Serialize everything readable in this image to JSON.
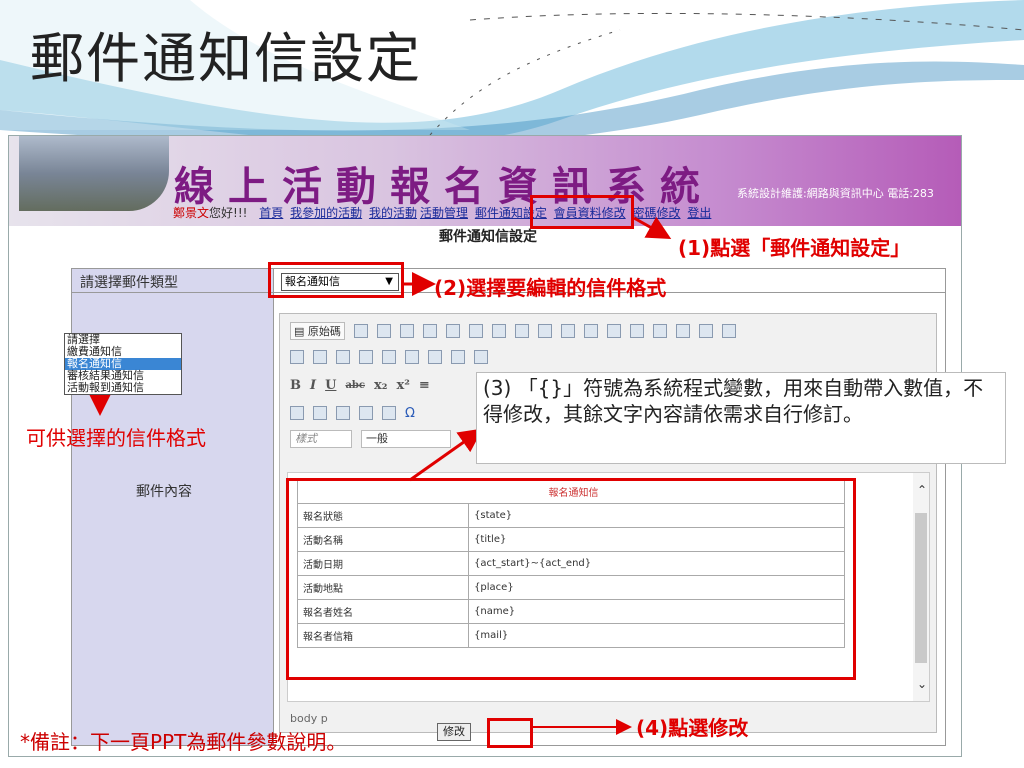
{
  "slide": {
    "title": "郵件通知信設定",
    "note": "*備註：下一頁PPT為郵件參數說明。"
  },
  "app": {
    "system_title": "線上活動報名資訊系統",
    "maintenance_text": "系統設計維護:網路與資訊中心 電話:283",
    "user_name": "鄭景文",
    "greeting": "您好!!!",
    "nav": [
      "首頁",
      "我參加的活動",
      "我的活動",
      "活動管理",
      "郵件通知設定",
      "會員資料修改",
      "密碼修改",
      "登出"
    ],
    "page_heading": "郵件通知信設定"
  },
  "form": {
    "type_label": "請選擇郵件類型",
    "type_selected": "報名通知信",
    "type_options": [
      "請選擇",
      "繳費通知信",
      "報名通知信",
      "審核結果通知信",
      "活動報到通知信"
    ],
    "content_label": "郵件內容",
    "modify_label": "修改"
  },
  "editor": {
    "source_label": "原始碼",
    "style_combo": "樣式",
    "format_combo": "一般",
    "path": "body  p",
    "template_header": "報名通知信",
    "rows": [
      {
        "label": "報名狀態",
        "value": "{state}"
      },
      {
        "label": "活動名稱",
        "value": "{title}"
      },
      {
        "label": "活動日期",
        "value": "{act_start}~{act_end}"
      },
      {
        "label": "活動地點",
        "value": "{place}"
      },
      {
        "label": "報名者姓名",
        "value": "{name}"
      },
      {
        "label": "報名者信箱",
        "value": "{mail}"
      }
    ]
  },
  "annotations": {
    "a1": "(1)點選「郵件通知設定」",
    "a2": "(2)選擇要編輯的信件格式",
    "a3": "(3) 「{}」符號為系統程式變數，用來自動帶入數值，不得修改，其餘文字內容請依需求自行修訂。",
    "a4": "(4)點選修改",
    "options_caption": "可供選擇的信件格式"
  },
  "colors": {
    "annotation_red": "#e00000",
    "banner_purple": "#7d1b83",
    "label_cell": "#d7d7ee",
    "selected_option": "#3a86d4"
  }
}
